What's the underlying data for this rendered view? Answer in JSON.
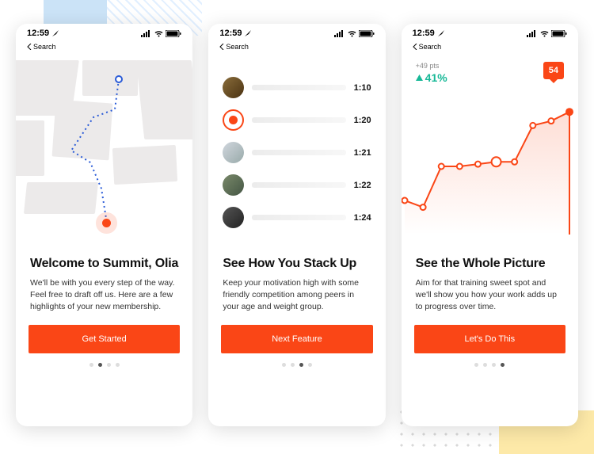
{
  "status": {
    "time": "12:59",
    "back_label": "Search"
  },
  "screens": [
    {
      "title": "Welcome to Summit, Olia",
      "desc": "We'll be with you every step of the way. Feel free to draft off us. Here are a few highlights of your new membership.",
      "cta": "Get Started",
      "dot_count": 4,
      "active_dot": 1
    },
    {
      "title": "See How You Stack Up",
      "desc": "Keep your motivation high with some friendly competition among peers in your age and weight group.",
      "cta": "Next Feature",
      "dot_count": 4,
      "active_dot": 2,
      "leaderboard": [
        {
          "time": "1:10",
          "me": false
        },
        {
          "time": "1:20",
          "me": true
        },
        {
          "time": "1:21",
          "me": false
        },
        {
          "time": "1:22",
          "me": false
        },
        {
          "time": "1:24",
          "me": false
        }
      ]
    },
    {
      "title": "See the Whole Picture",
      "desc": "Aim for that training sweet spot and we'll show you how your work adds up to progress over time.",
      "cta": "Let's Do This",
      "dot_count": 4,
      "active_dot": 3,
      "chart_summary": {
        "delta_pts": "+49 pts",
        "pct": "41%",
        "badge": "54"
      }
    }
  ],
  "chart_data": {
    "type": "line",
    "title": "",
    "xlabel": "",
    "ylabel": "",
    "x": [
      0,
      1,
      2,
      3,
      4,
      5,
      6,
      7,
      8,
      9
    ],
    "values": [
      15,
      12,
      30,
      30,
      31,
      32,
      32,
      48,
      50,
      54
    ],
    "ylim": [
      0,
      60
    ],
    "highlight_index": 9,
    "annotations": {
      "badge_value": 54,
      "delta_points": 49,
      "percent_change": 41
    }
  },
  "colors": {
    "accent": "#fa4616",
    "positive": "#17b897"
  }
}
